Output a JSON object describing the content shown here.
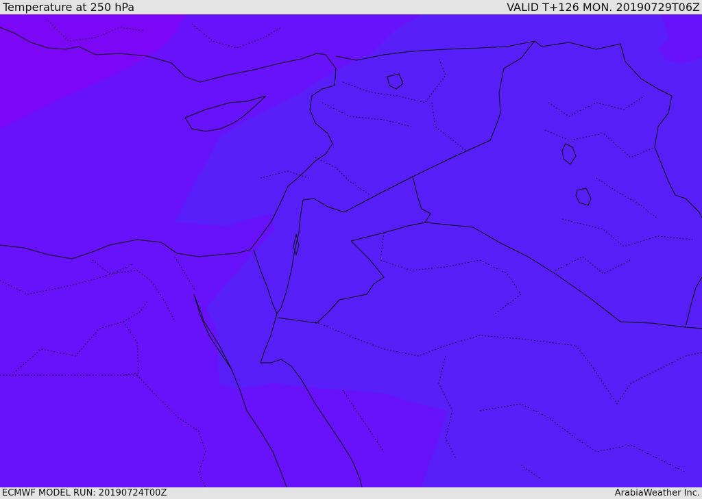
{
  "header": {
    "title": "Temperature at 250 hPa",
    "valid": "VALID T+126 MON. 20190729T06Z"
  },
  "footer": {
    "model_run": "ECMWF MODEL RUN: 20190724T00Z",
    "credit": "ArabiaWeather Inc."
  },
  "map": {
    "field": "temperature at 250 hPa",
    "colors": {
      "cold_northwest": "#7c07f6",
      "mid_west": "#6811fb",
      "warm_east": "#581ef7",
      "border_line": "#0a0a0a"
    }
  }
}
